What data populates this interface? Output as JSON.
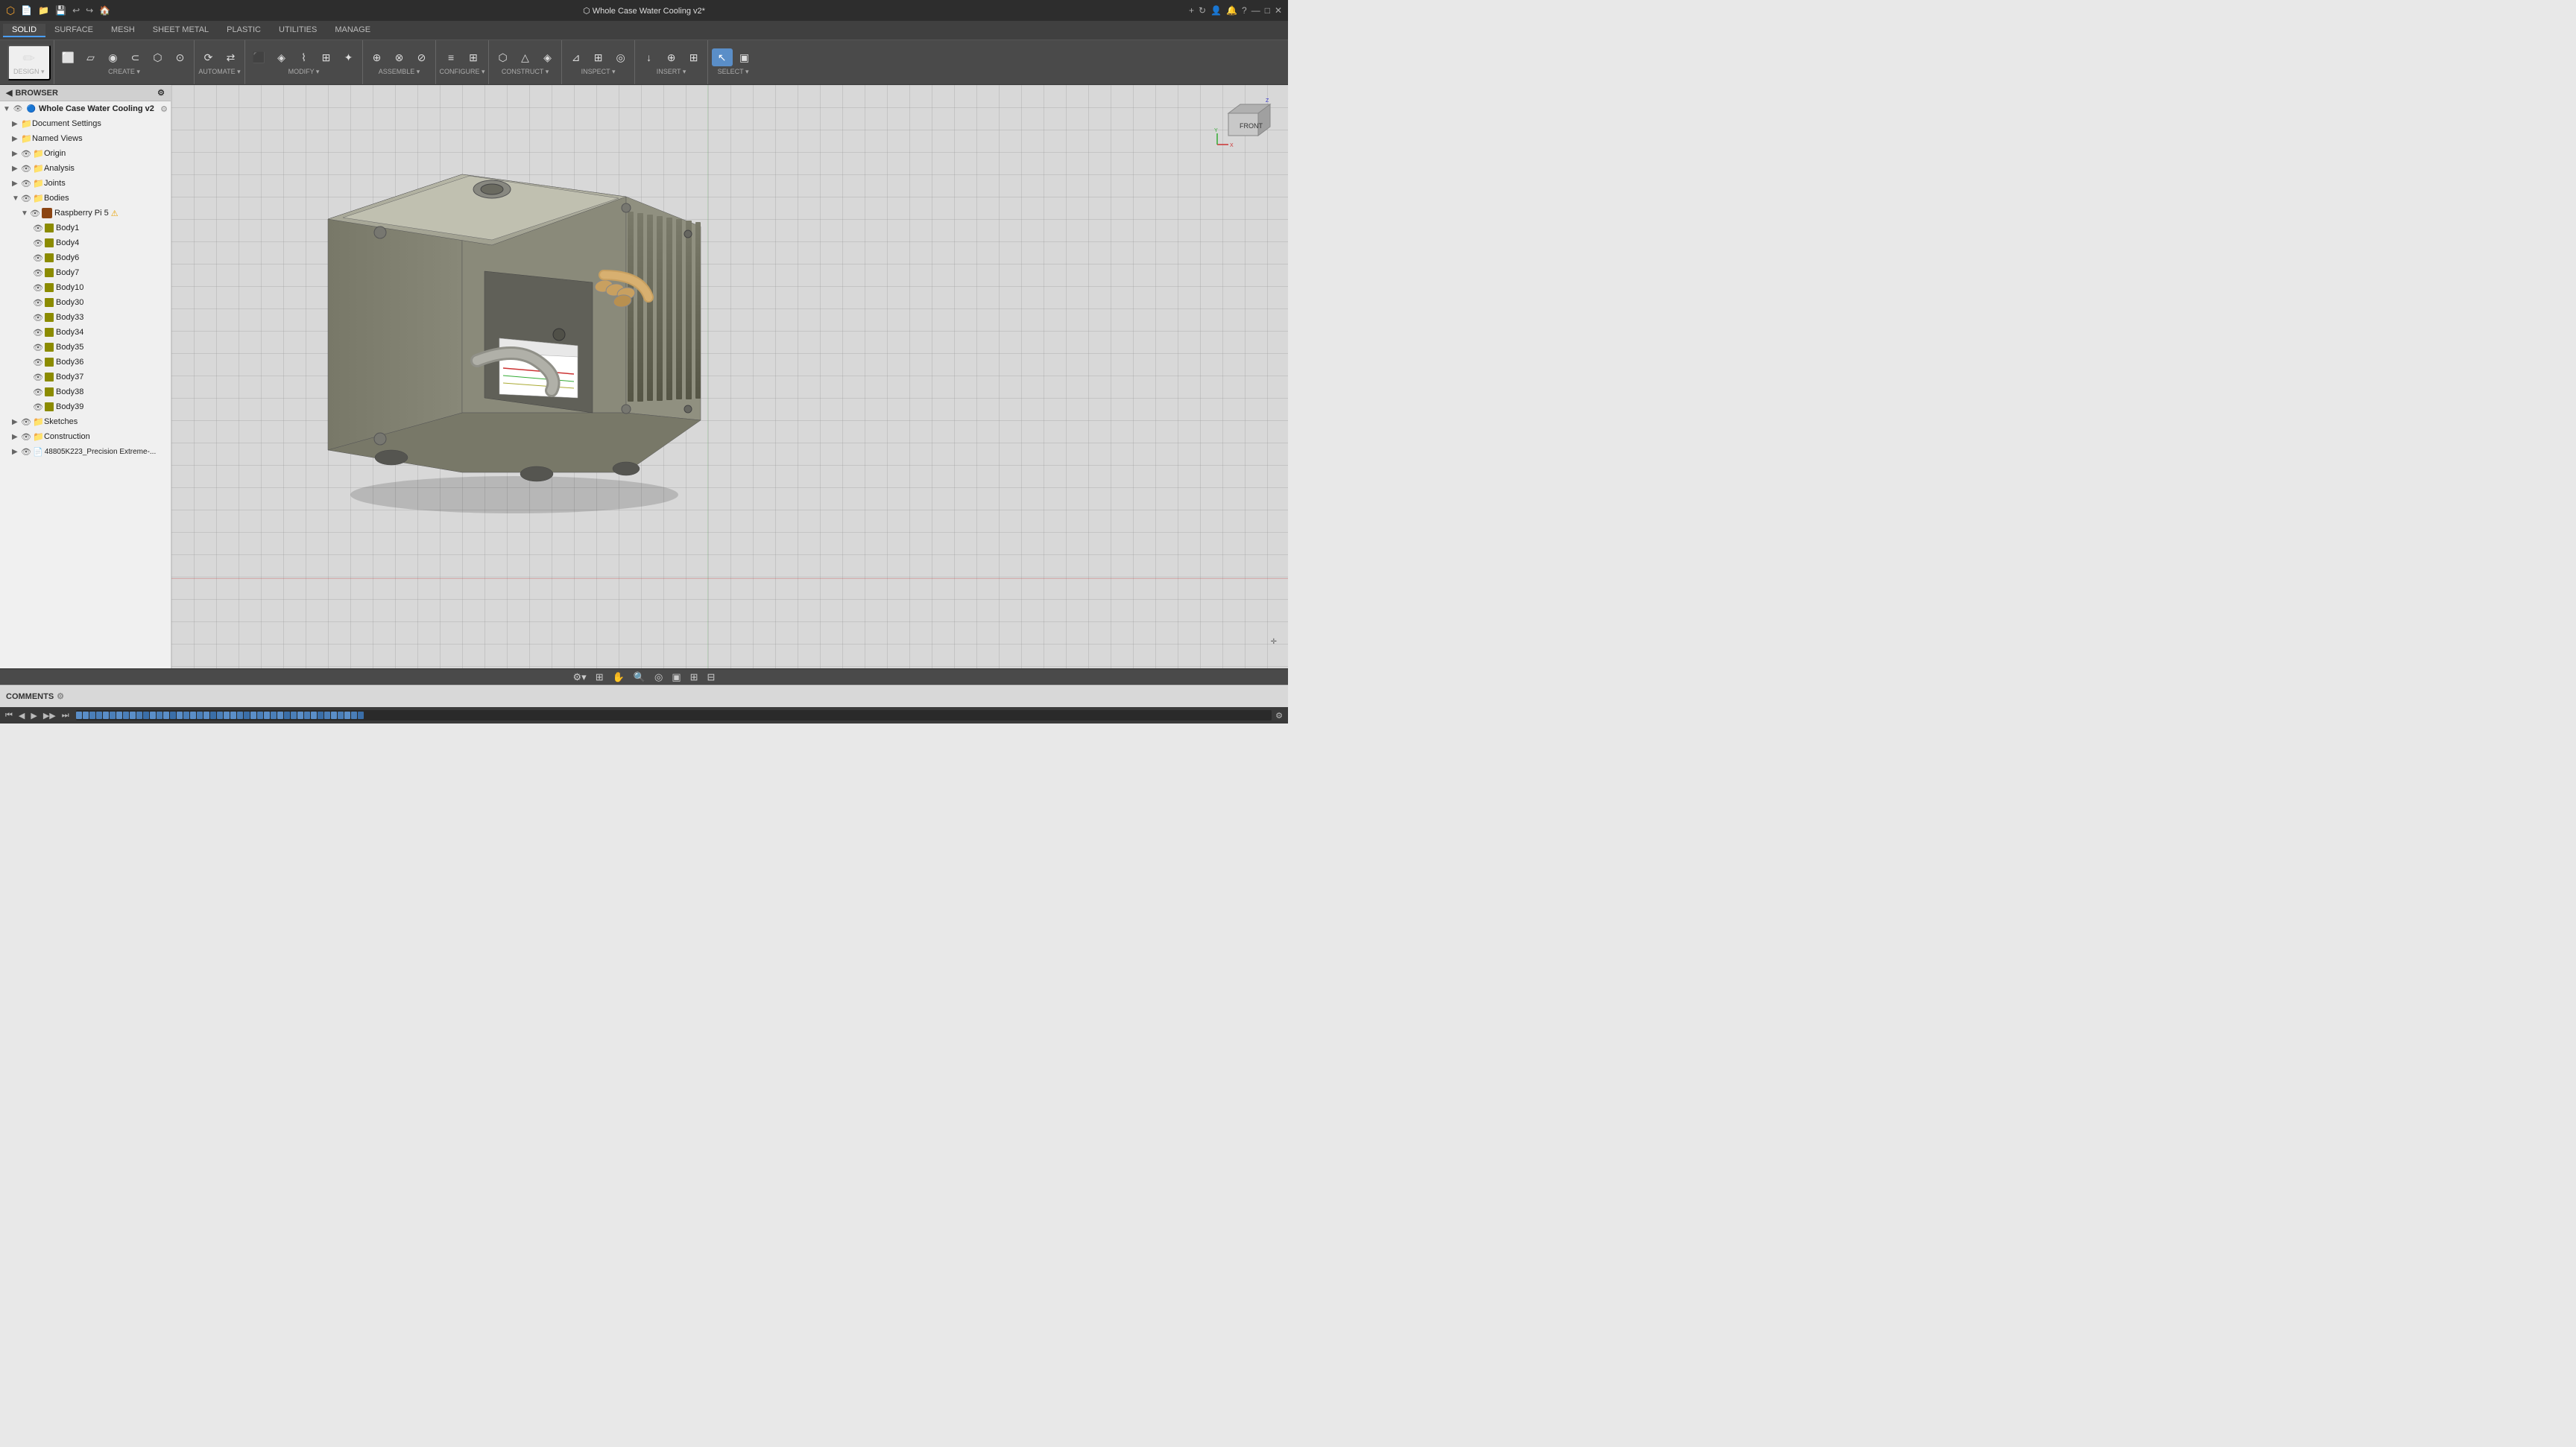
{
  "titlebar": {
    "title": "⬡ Whole Case Water Cooling v2*",
    "app_name": "Autodesk Fusion 360"
  },
  "menubar": {
    "items": [
      "DESIGN ▾",
      "SURFACE",
      "MESH",
      "SHEET METAL",
      "PLASTIC",
      "UTILITIES",
      "MANAGE"
    ]
  },
  "tabs": {
    "active": "SOLID",
    "items": [
      "SOLID",
      "SURFACE",
      "MESH",
      "SHEET METAL",
      "PLASTIC",
      "UTILITIES",
      "MANAGE"
    ]
  },
  "toolbar": {
    "groups": [
      {
        "label": "CREATE ▾",
        "icons": [
          "▱",
          "⬜",
          "◉",
          "◎",
          "⬡",
          "⬤"
        ]
      },
      {
        "label": "AUTOMATE ▾",
        "icons": [
          "⟳",
          "⇄"
        ]
      },
      {
        "label": "MODIFY ▾",
        "icons": [
          "⬛",
          "◈",
          "⌇",
          "⊞",
          "✦"
        ]
      },
      {
        "label": "ASSEMBLE ▾",
        "icons": [
          "⊕",
          "⊗",
          "⊘"
        ]
      },
      {
        "label": "CONFIGURE ▾",
        "icons": [
          "≡",
          "⊞"
        ]
      },
      {
        "label": "CONSTRUCT ▾",
        "icons": [
          "⬡",
          "△",
          "◈"
        ]
      },
      {
        "label": "INSPECT ▾",
        "icons": [
          "⊿",
          "⊞",
          "◎"
        ]
      },
      {
        "label": "INSERT ▾",
        "icons": [
          "↓",
          "⊕",
          "⊞"
        ]
      },
      {
        "label": "SELECT ▾",
        "icons": [
          "↖",
          "▣"
        ]
      }
    ]
  },
  "browser": {
    "title": "BROWSER",
    "tree": [
      {
        "id": "root",
        "label": "Whole Case Water Cooling v2",
        "level": 0,
        "type": "document",
        "expanded": true,
        "eye": true
      },
      {
        "id": "doc-settings",
        "label": "Document Settings",
        "level": 1,
        "type": "folder",
        "expanded": false,
        "eye": false
      },
      {
        "id": "named-views",
        "label": "Named Views",
        "level": 1,
        "type": "folder",
        "expanded": false,
        "eye": false
      },
      {
        "id": "origin",
        "label": "Origin",
        "level": 1,
        "type": "folder",
        "expanded": false,
        "eye": true
      },
      {
        "id": "analysis",
        "label": "Analysis",
        "level": 1,
        "type": "folder",
        "expanded": false,
        "eye": true
      },
      {
        "id": "joints",
        "label": "Joints",
        "level": 1,
        "type": "folder",
        "expanded": false,
        "eye": true
      },
      {
        "id": "bodies",
        "label": "Bodies",
        "level": 1,
        "type": "folder",
        "expanded": true,
        "eye": true
      },
      {
        "id": "raspi5",
        "label": "Raspberry Pi 5",
        "level": 2,
        "type": "component",
        "expanded": true,
        "eye": true,
        "warning": true
      },
      {
        "id": "body1",
        "label": "Body1",
        "level": 3,
        "type": "body",
        "eye": true
      },
      {
        "id": "body4",
        "label": "Body4",
        "level": 3,
        "type": "body",
        "eye": true
      },
      {
        "id": "body6",
        "label": "Body6",
        "level": 3,
        "type": "body",
        "eye": true
      },
      {
        "id": "body7",
        "label": "Body7",
        "level": 3,
        "type": "body",
        "eye": true
      },
      {
        "id": "body10",
        "label": "Body10",
        "level": 3,
        "type": "body",
        "eye": true
      },
      {
        "id": "body30",
        "label": "Body30",
        "level": 3,
        "type": "body",
        "eye": true
      },
      {
        "id": "body33",
        "label": "Body33",
        "level": 3,
        "type": "body",
        "eye": true
      },
      {
        "id": "body34",
        "label": "Body34",
        "level": 3,
        "type": "body",
        "eye": true
      },
      {
        "id": "body35",
        "label": "Body35",
        "level": 3,
        "type": "body",
        "eye": true
      },
      {
        "id": "body36",
        "label": "Body36",
        "level": 3,
        "type": "body",
        "eye": true
      },
      {
        "id": "body37",
        "label": "Body37",
        "level": 3,
        "type": "body",
        "eye": true
      },
      {
        "id": "body38",
        "label": "Body38",
        "level": 3,
        "type": "body",
        "eye": true
      },
      {
        "id": "body39",
        "label": "Body39",
        "level": 3,
        "type": "body",
        "eye": true
      },
      {
        "id": "sketches",
        "label": "Sketches",
        "level": 1,
        "type": "folder",
        "expanded": false,
        "eye": true
      },
      {
        "id": "construction",
        "label": "Construction",
        "level": 1,
        "type": "folder",
        "expanded": false,
        "eye": true
      },
      {
        "id": "ref-file",
        "label": "48805K223_Precision Extreme-...",
        "level": 1,
        "type": "file",
        "expanded": false,
        "eye": true
      }
    ]
  },
  "viewport": {
    "model_title": "Whole Case Water Cooling v2",
    "cursor_pos": "989, 362"
  },
  "bottom_toolbar": {
    "icons": [
      "⚙",
      "⊞",
      "✋",
      "🔍",
      "◉",
      "▣",
      "⊞",
      "⊟"
    ]
  },
  "statusbar": {
    "comments_label": "COMMENTS",
    "settings_icon": "⚙"
  },
  "anim_toolbar": {
    "buttons": [
      "⏮",
      "◀",
      "▶▶",
      "⏭"
    ],
    "timeline_items": 60
  },
  "construct_label": "CONSTRUCT -",
  "viewcube": {
    "face": "FRONT"
  }
}
